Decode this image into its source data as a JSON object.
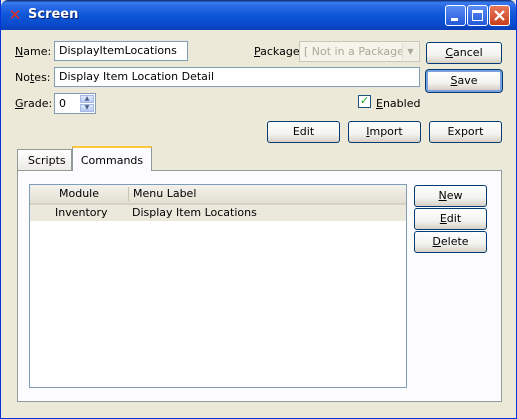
{
  "window": {
    "title": "Screen",
    "buttons": {
      "minimize": "_",
      "maximize": "□",
      "close": "✕"
    }
  },
  "form": {
    "name_label_prefix": "N",
    "name_label_rest": "ame:",
    "name_value": "DisplayItemLocations",
    "package_label_prefix": "P",
    "package_label_rest": "ackage:",
    "package_value": "[ Not in a Package ]",
    "notes_label_prefix": "No",
    "notes_label_ul": "t",
    "notes_label_rest": "es:",
    "notes_value": "Display Item Location Detail",
    "grade_label_prefix": "G",
    "grade_label_rest": "rade:",
    "grade_value": "0",
    "enabled_label_prefix": "E",
    "enabled_label_rest": "nabled",
    "enabled_checked": true
  },
  "buttons": {
    "cancel_ul": "C",
    "cancel_rest": "ancel",
    "save_ul": "S",
    "save_rest": "ave",
    "edit": "Edit",
    "import_ul": "I",
    "import_rest": "mport",
    "export": "Export"
  },
  "tabs": [
    {
      "label": "Scripts",
      "active": false
    },
    {
      "label": "Commands",
      "active": true
    }
  ],
  "commands_table": {
    "columns": [
      "Module",
      "Menu Label"
    ],
    "rows": [
      {
        "module": "Inventory",
        "menu_label": "Display Item Locations"
      }
    ]
  },
  "commands_buttons": {
    "new_ul": "N",
    "new_rest": "ew",
    "edit_ul": "E",
    "edit_rest": "dit",
    "delete_ul": "D",
    "delete_rest": "elete"
  },
  "colors": {
    "titlebar": "#0e56d8",
    "window_bg": "#ece9d8",
    "selected_row": "#ebe9dc",
    "tab_highlight": "#ffc83c"
  }
}
